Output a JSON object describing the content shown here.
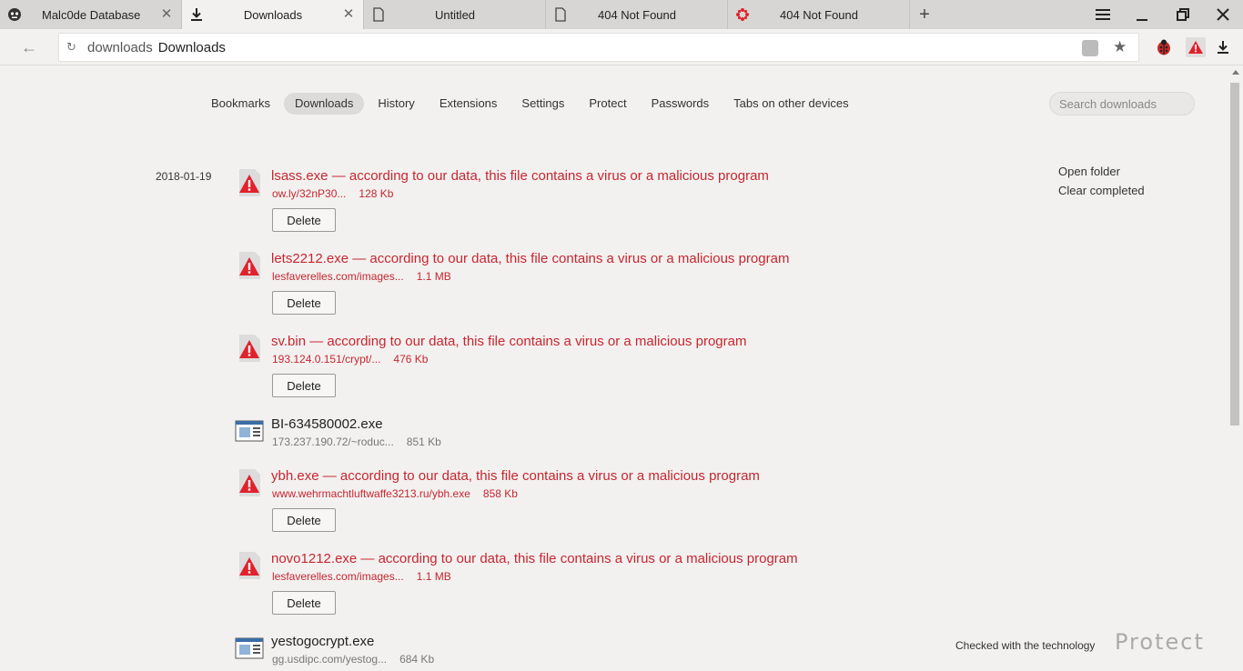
{
  "tabs": [
    {
      "title": "Malc0de Database",
      "icon": "malcode-favicon",
      "has_close": true,
      "active": false
    },
    {
      "title": "Downloads",
      "icon": "download-icon",
      "has_close": true,
      "active": true
    },
    {
      "title": "Untitled",
      "icon": "page-icon",
      "has_close": false,
      "active": false
    },
    {
      "title": "404 Not Found",
      "icon": "page-icon",
      "has_close": false,
      "active": false
    },
    {
      "title": "404 Not Found",
      "icon": "red-flower-icon",
      "has_close": false,
      "active": false
    }
  ],
  "addressbar": {
    "url_prefix": "downloads",
    "url_title": "Downloads"
  },
  "nav": {
    "items": [
      "Bookmarks",
      "Downloads",
      "History",
      "Extensions",
      "Settings",
      "Protect",
      "Passwords",
      "Tabs on other devices"
    ],
    "active": "Downloads"
  },
  "search": {
    "placeholder": "Search downloads"
  },
  "date": "2018-01-19",
  "actions": {
    "open_folder": "Open folder",
    "clear_completed": "Clear completed"
  },
  "delete_label": "Delete",
  "downloads": [
    {
      "name": "lsass.exe — according to our data, this file contains a virus or a malicious program",
      "source": "ow.ly/32nP30...",
      "size": "128 Kb",
      "malicious": true
    },
    {
      "name": "lets2212.exe — according to our data, this file contains a virus or a malicious program",
      "source": "lesfaverelles.com/images...",
      "size": "1.1 MB",
      "malicious": true
    },
    {
      "name": "sv.bin — according to our data, this file contains a virus or a malicious program",
      "source": "193.124.0.151/crypt/...",
      "size": "476 Kb",
      "malicious": true
    },
    {
      "name": "BI-634580002.exe",
      "source": "173.237.190.72/~roduc...",
      "size": "851 Kb",
      "malicious": false
    },
    {
      "name": "ybh.exe — according to our data, this file contains a virus or a malicious program",
      "source": "www.wehrmachtluftwaffe3213.ru/ybh.exe",
      "size": "858 Kb",
      "malicious": true
    },
    {
      "name": "novo1212.exe — according to our data, this file contains a virus or a malicious program",
      "source": "lesfaverelles.com/images...",
      "size": "1.1 MB",
      "malicious": true
    },
    {
      "name": "yestogocrypt.exe",
      "source": "gg.usdipc.com/yestog...",
      "size": "684 Kb",
      "malicious": false
    }
  ],
  "footer": {
    "text": "Checked with the technology",
    "brand": "Protect"
  },
  "colors": {
    "danger": "#c8262f",
    "background": "#f2f1f0",
    "tabstrip": "#d8d6d4"
  }
}
